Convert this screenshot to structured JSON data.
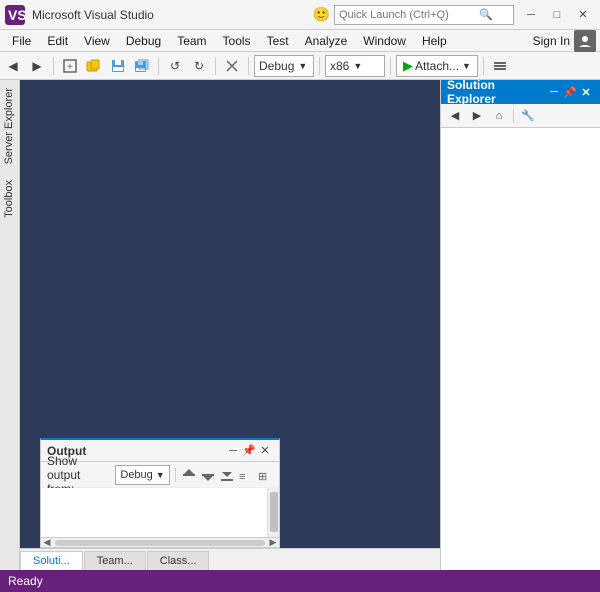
{
  "titlebar": {
    "title": "Microsoft Visual Studio",
    "search_placeholder": "Quick Launch (Ctrl+Q)",
    "search_icon": "🔍",
    "smiley": "🙂",
    "min_btn": "─",
    "max_btn": "□",
    "close_btn": "✕"
  },
  "menubar": {
    "items": [
      "File",
      "Edit",
      "View",
      "Debug",
      "Team",
      "Tools",
      "Test",
      "Analyze",
      "Window",
      "Help"
    ],
    "signin": "Sign In"
  },
  "toolbar": {
    "back_btn": "◀",
    "forward_btn": "▶",
    "debug_config": "Debug",
    "platform": "x86",
    "attach_label": "Attach...",
    "undo_btn": "↺",
    "redo_btn": "↻"
  },
  "left_tabs": {
    "server_explorer": "Server Explorer",
    "toolbox": "Toolbox"
  },
  "solution_explorer": {
    "title": "Solution Explorer",
    "pin_btn": "📌",
    "close_btn": "✕",
    "nav_back": "◀",
    "nav_forward": "▶",
    "nav_home": "⌂",
    "settings_btn": "🔧"
  },
  "output_panel": {
    "title": "Output",
    "show_from_label": "Show output from:",
    "source": "Debug",
    "pin_btn": "📌",
    "close_btn": "✕",
    "scroll_up_icon": "▲",
    "scroll_down_icon": "▼",
    "scroll_left_icon": "◀",
    "scroll_right_icon": "▶"
  },
  "bottom_tabs": [
    {
      "label": "Soluti...",
      "active": true
    },
    {
      "label": "Team...",
      "active": false
    },
    {
      "label": "Class...",
      "active": false
    }
  ],
  "statusbar": {
    "text": "Ready"
  }
}
